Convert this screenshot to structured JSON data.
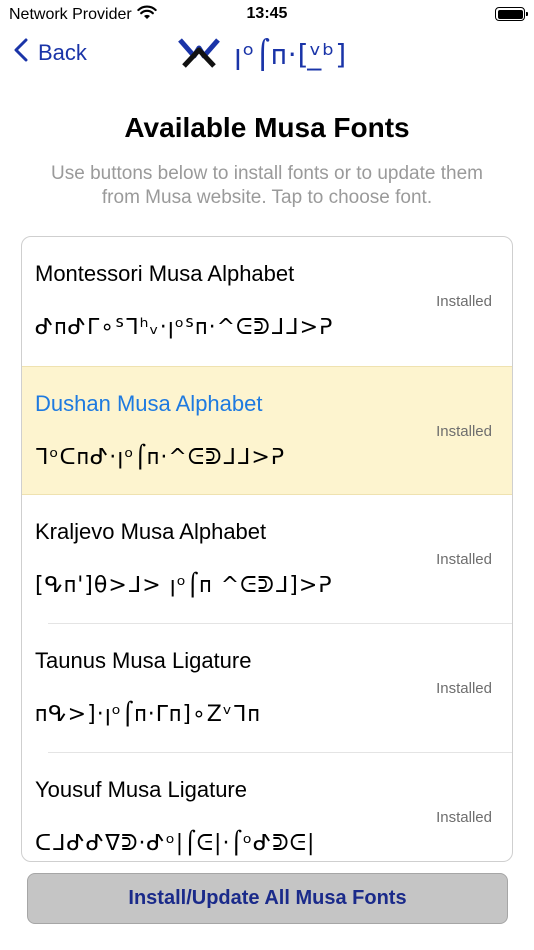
{
  "status_bar": {
    "carrier": "Network Provider",
    "time": "13:45",
    "icons": [
      "wifi-icon",
      "battery-icon"
    ]
  },
  "nav": {
    "back_label": "Back",
    "back_icon": "chevron-left-icon",
    "logo_icon": "musa-logo-icon",
    "title_script": "ꞁᵒ⌠ᴨ·[ᵛ̲ᵇ]",
    "accent_color": "#1a34a8"
  },
  "header": {
    "title": "Available Musa Fonts",
    "subtitle": "Use buttons below to install fonts or to update them from Musa website. Tap to choose font."
  },
  "fonts": [
    {
      "name": "Montessori Musa Alphabet",
      "status": "Installed",
      "sample": "ᕷᴨᕷᒥ∘ᔆᒣʰᵥ·ꞁᵒᔆᴨ·^ᕮᕲᒧᒧ>ᕈ",
      "selected": false
    },
    {
      "name": "Dushan Musa Alphabet",
      "status": "Installed",
      "sample": "ᒣᵒᑕᴨᕷ·ꞁᵒ⌠ᴨ·^ᕮᕲᒧᒧ>ᕈ",
      "selected": true
    },
    {
      "name": "Kraljevo Musa Alphabet",
      "status": "Installed",
      "sample": "[ᕴᴨ']θ>ᒧ> ꞁᵒ⌠ᴨ ^ᕮᕲᒧ]>ᕈ",
      "selected": false
    },
    {
      "name": "Taunus Musa Ligature",
      "status": "Installed",
      "sample": "ᴨᕴ>]·ꞁᵒ⌠ᴨ·ᒥᴨ]∘Zᵛᒣᴨ",
      "selected": false
    },
    {
      "name": "Yousuf Musa Ligature",
      "status": "Installed",
      "sample": "ᑕᒧᕷᕷᐁᕲ·ᕷᵒ|⌠ᕮ|·⌠ᵒᕷᕲᕮ|",
      "selected": false
    }
  ],
  "footer": {
    "install_all_label": "Install/Update All Musa Fonts"
  },
  "colors": {
    "selected_row_bg": "#fdf4cf",
    "selected_name": "#1e7ae0",
    "button_text": "#1a2a8a"
  }
}
